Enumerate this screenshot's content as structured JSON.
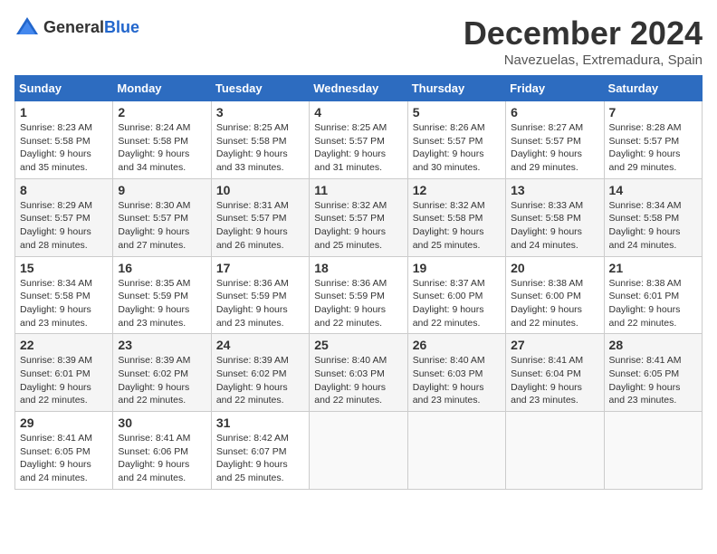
{
  "header": {
    "logo_general": "General",
    "logo_blue": "Blue",
    "month_title": "December 2024",
    "subtitle": "Navezuelas, Extremadura, Spain"
  },
  "days_of_week": [
    "Sunday",
    "Monday",
    "Tuesday",
    "Wednesday",
    "Thursday",
    "Friday",
    "Saturday"
  ],
  "weeks": [
    [
      {
        "day": "1",
        "info": "Sunrise: 8:23 AM\nSunset: 5:58 PM\nDaylight: 9 hours and 35 minutes."
      },
      {
        "day": "2",
        "info": "Sunrise: 8:24 AM\nSunset: 5:58 PM\nDaylight: 9 hours and 34 minutes."
      },
      {
        "day": "3",
        "info": "Sunrise: 8:25 AM\nSunset: 5:58 PM\nDaylight: 9 hours and 33 minutes."
      },
      {
        "day": "4",
        "info": "Sunrise: 8:25 AM\nSunset: 5:57 PM\nDaylight: 9 hours and 31 minutes."
      },
      {
        "day": "5",
        "info": "Sunrise: 8:26 AM\nSunset: 5:57 PM\nDaylight: 9 hours and 30 minutes."
      },
      {
        "day": "6",
        "info": "Sunrise: 8:27 AM\nSunset: 5:57 PM\nDaylight: 9 hours and 29 minutes."
      },
      {
        "day": "7",
        "info": "Sunrise: 8:28 AM\nSunset: 5:57 PM\nDaylight: 9 hours and 29 minutes."
      }
    ],
    [
      {
        "day": "8",
        "info": "Sunrise: 8:29 AM\nSunset: 5:57 PM\nDaylight: 9 hours and 28 minutes."
      },
      {
        "day": "9",
        "info": "Sunrise: 8:30 AM\nSunset: 5:57 PM\nDaylight: 9 hours and 27 minutes."
      },
      {
        "day": "10",
        "info": "Sunrise: 8:31 AM\nSunset: 5:57 PM\nDaylight: 9 hours and 26 minutes."
      },
      {
        "day": "11",
        "info": "Sunrise: 8:32 AM\nSunset: 5:57 PM\nDaylight: 9 hours and 25 minutes."
      },
      {
        "day": "12",
        "info": "Sunrise: 8:32 AM\nSunset: 5:58 PM\nDaylight: 9 hours and 25 minutes."
      },
      {
        "day": "13",
        "info": "Sunrise: 8:33 AM\nSunset: 5:58 PM\nDaylight: 9 hours and 24 minutes."
      },
      {
        "day": "14",
        "info": "Sunrise: 8:34 AM\nSunset: 5:58 PM\nDaylight: 9 hours and 24 minutes."
      }
    ],
    [
      {
        "day": "15",
        "info": "Sunrise: 8:34 AM\nSunset: 5:58 PM\nDaylight: 9 hours and 23 minutes."
      },
      {
        "day": "16",
        "info": "Sunrise: 8:35 AM\nSunset: 5:59 PM\nDaylight: 9 hours and 23 minutes."
      },
      {
        "day": "17",
        "info": "Sunrise: 8:36 AM\nSunset: 5:59 PM\nDaylight: 9 hours and 23 minutes."
      },
      {
        "day": "18",
        "info": "Sunrise: 8:36 AM\nSunset: 5:59 PM\nDaylight: 9 hours and 22 minutes."
      },
      {
        "day": "19",
        "info": "Sunrise: 8:37 AM\nSunset: 6:00 PM\nDaylight: 9 hours and 22 minutes."
      },
      {
        "day": "20",
        "info": "Sunrise: 8:38 AM\nSunset: 6:00 PM\nDaylight: 9 hours and 22 minutes."
      },
      {
        "day": "21",
        "info": "Sunrise: 8:38 AM\nSunset: 6:01 PM\nDaylight: 9 hours and 22 minutes."
      }
    ],
    [
      {
        "day": "22",
        "info": "Sunrise: 8:39 AM\nSunset: 6:01 PM\nDaylight: 9 hours and 22 minutes."
      },
      {
        "day": "23",
        "info": "Sunrise: 8:39 AM\nSunset: 6:02 PM\nDaylight: 9 hours and 22 minutes."
      },
      {
        "day": "24",
        "info": "Sunrise: 8:39 AM\nSunset: 6:02 PM\nDaylight: 9 hours and 22 minutes."
      },
      {
        "day": "25",
        "info": "Sunrise: 8:40 AM\nSunset: 6:03 PM\nDaylight: 9 hours and 22 minutes."
      },
      {
        "day": "26",
        "info": "Sunrise: 8:40 AM\nSunset: 6:03 PM\nDaylight: 9 hours and 23 minutes."
      },
      {
        "day": "27",
        "info": "Sunrise: 8:41 AM\nSunset: 6:04 PM\nDaylight: 9 hours and 23 minutes."
      },
      {
        "day": "28",
        "info": "Sunrise: 8:41 AM\nSunset: 6:05 PM\nDaylight: 9 hours and 23 minutes."
      }
    ],
    [
      {
        "day": "29",
        "info": "Sunrise: 8:41 AM\nSunset: 6:05 PM\nDaylight: 9 hours and 24 minutes."
      },
      {
        "day": "30",
        "info": "Sunrise: 8:41 AM\nSunset: 6:06 PM\nDaylight: 9 hours and 24 minutes."
      },
      {
        "day": "31",
        "info": "Sunrise: 8:42 AM\nSunset: 6:07 PM\nDaylight: 9 hours and 25 minutes."
      },
      {
        "day": "",
        "info": ""
      },
      {
        "day": "",
        "info": ""
      },
      {
        "day": "",
        "info": ""
      },
      {
        "day": "",
        "info": ""
      }
    ]
  ]
}
